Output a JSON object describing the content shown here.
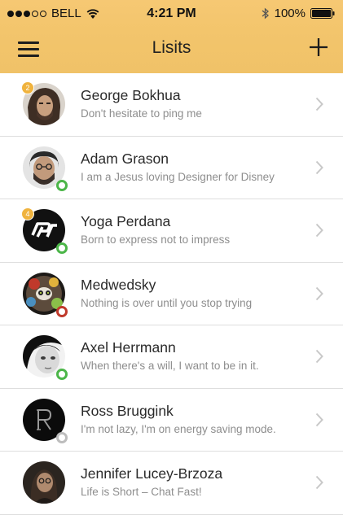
{
  "status_bar": {
    "carrier": "BELL",
    "time": "4:21 PM",
    "battery": "100%"
  },
  "nav": {
    "title": "Lisits",
    "left_icon": "hamburger-menu-icon",
    "right_icon": "plus-icon"
  },
  "colors": {
    "header_accent": "#f3c56c",
    "badge": "#f0b33e",
    "online": "#4cb649",
    "busy": "#c0392b",
    "offline": "#bdbdbd",
    "secondary_text": "#8e8e8e"
  },
  "contacts": [
    {
      "name": "George Bokhua",
      "status": "Don't hesitate to ping me",
      "badge": "2",
      "presence": "none"
    },
    {
      "name": "Adam Grason",
      "status": "I am a Jesus loving Designer for Disney",
      "badge": "",
      "presence": "online"
    },
    {
      "name": "Yoga Perdana",
      "status": "Born to express not to impress",
      "badge": "4",
      "presence": "online"
    },
    {
      "name": "Medwedsky",
      "status": "Nothing is over until you stop trying",
      "badge": "",
      "presence": "busy"
    },
    {
      "name": "Axel Herrmann",
      "status": "When there's a will, I want to be in it.",
      "badge": "",
      "presence": "online"
    },
    {
      "name": "Ross Bruggink",
      "status": "I'm not lazy, I'm on energy saving mode.",
      "badge": "",
      "presence": "offline"
    },
    {
      "name": "Jennifer Lucey-Brzoza",
      "status": "Life is Short – Chat Fast!",
      "badge": "",
      "presence": "none"
    }
  ]
}
